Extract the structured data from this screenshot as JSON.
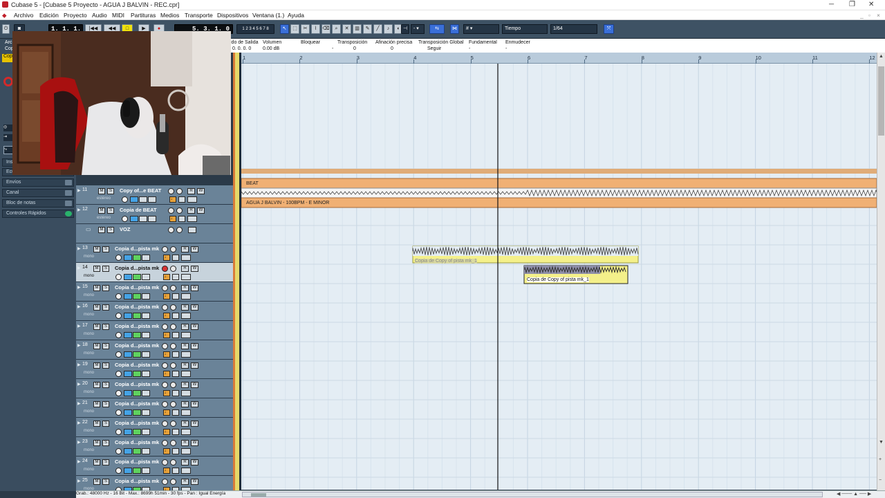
{
  "window": {
    "title": "Cubase 5 - [Cubase 5 Proyecto - AGUA J BALVIN - REC.cpr]"
  },
  "menu": [
    "Archivo",
    "Edición",
    "Proyecto",
    "Audio",
    "MIDI",
    "Partituras",
    "Medios",
    "Transporte",
    "Dispositivos",
    "Ventana (1.)",
    "Ayuda"
  ],
  "transport": {
    "left_locator": "1. 1. 1. 0",
    "position": "5. 3. 1. 0"
  },
  "toolbar": {
    "snap_type": "Tiempo",
    "quantize": "1/64"
  },
  "infoline": {
    "labels": [
      "ido de Salida",
      "Volumen",
      "Bloquear",
      "Transposición",
      "Afinación precisa",
      "Transposición Global",
      "Fundamental",
      "Enmudecer"
    ],
    "values": [
      "0. 0. 0. 0",
      "0.00 dB",
      "-",
      "0",
      "0",
      "Seguir",
      "-",
      "-"
    ]
  },
  "left_panel": {
    "top_labels": [
      "Arc",
      "Cop",
      "Cop"
    ],
    "inspector_items": [
      "Ins",
      "Ecu",
      "Envíos",
      "Canal",
      "Bloc de notas",
      "Controles Rápidos"
    ]
  },
  "tracks": [
    {
      "num": "11",
      "name": "Copy of...e BEAT",
      "sub": "estéreo"
    },
    {
      "num": "12",
      "name": "Copia de BEAT",
      "sub": "estéreo"
    },
    {
      "num": "",
      "name": "VOZ",
      "sub": ""
    },
    {
      "num": "13",
      "name": "Copia d...pista mk",
      "sub": "mono"
    },
    {
      "num": "14",
      "name": "Copia d...pista mk",
      "sub": "mono"
    },
    {
      "num": "15",
      "name": "Copia d...pista mk",
      "sub": "mono"
    },
    {
      "num": "16",
      "name": "Copia d...pista mk",
      "sub": "mono"
    },
    {
      "num": "17",
      "name": "Copia d...pista mk",
      "sub": "mono"
    },
    {
      "num": "18",
      "name": "Copia d...pista mk",
      "sub": "mono"
    },
    {
      "num": "19",
      "name": "Copia d...pista mk",
      "sub": "mono"
    },
    {
      "num": "20",
      "name": "Copia d...pista mk",
      "sub": "mono"
    },
    {
      "num": "21",
      "name": "Copia d...pista mk",
      "sub": "mono"
    },
    {
      "num": "22",
      "name": "Copia d...pista mk",
      "sub": "mono"
    },
    {
      "num": "23",
      "name": "Copia d...pista mk",
      "sub": "mono"
    },
    {
      "num": "24",
      "name": "Copia d...pista mk",
      "sub": "mono"
    },
    {
      "num": "25",
      "name": "Copia d...pista mk",
      "sub": "mono"
    }
  ],
  "ruler": {
    "bars": [
      "1",
      "2",
      "3",
      "4",
      "5",
      "6",
      "7",
      "8",
      "9",
      "10",
      "11",
      "12"
    ]
  },
  "events": {
    "beat": "BEAT",
    "info": "AGUA J BALVIN - 100BPM - E MINOR",
    "clip1": "Copia de Copy of pista mk_1",
    "clip2": "Copia de Copy of pista mk_1"
  },
  "status": "Grab.: 48000 Hz - 16 Bit - Max.: 8699h 51min - 30 fps - Pan : Igual Energía"
}
